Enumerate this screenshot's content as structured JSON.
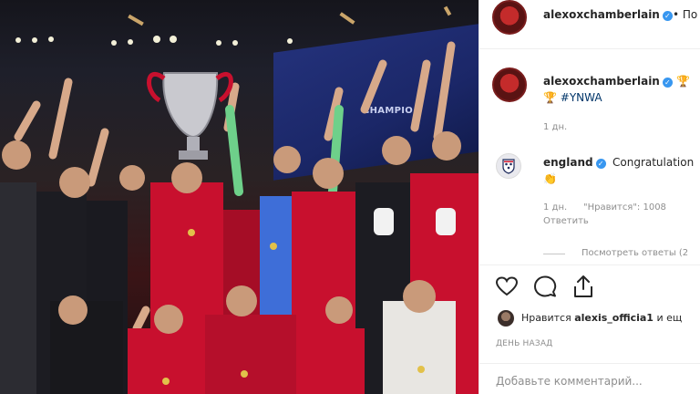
{
  "post": {
    "image_alt": "Liverpool players celebrating with the Champions League trophy",
    "banner_text": "CHAMPIO"
  },
  "header": {
    "username": "alexoxchamberlain",
    "separator": "•",
    "follow_label": "По"
  },
  "caption": {
    "username": "alexoxchamberlain",
    "hashtag": "#YNWA",
    "emoji": "🏆",
    "time": "1 дн."
  },
  "comment": {
    "username": "england",
    "text": "Congratulation",
    "emoji": "👏",
    "time": "1 дн.",
    "likes": "\"Нравится\": 1008",
    "reply_label": "Ответить",
    "view_replies": "Посмотреть ответы (2"
  },
  "likes": {
    "prefix": "Нравится",
    "user": "alexis_officia1",
    "suffix": "и ещ"
  },
  "timestamp": "ДЕНЬ НАЗАД",
  "add_comment": {
    "placeholder": "Добавьте комментарий..."
  },
  "colors": {
    "link": "#003569",
    "verified": "#3897f0",
    "meta": "#8e8e8e",
    "liverpool_red": "#c8102e"
  },
  "icons": [
    "heart-icon",
    "comment-icon",
    "share-icon",
    "verified-icon",
    "trophy-emoji",
    "clap-emoji"
  ]
}
